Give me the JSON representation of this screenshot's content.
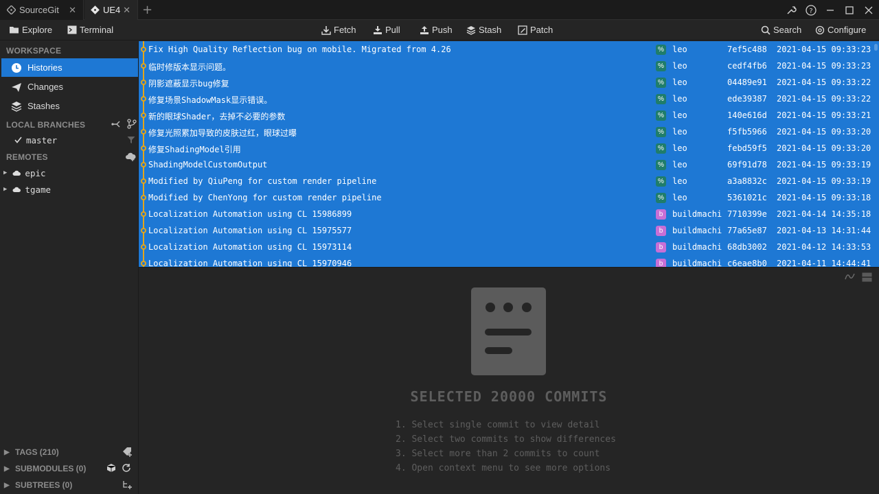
{
  "tabs": [
    {
      "label": "SourceGit",
      "close": "✕"
    },
    {
      "label": "UE4",
      "close": "✕"
    }
  ],
  "new_tab": "+",
  "toolbar": {
    "explore": "Explore",
    "terminal": "Terminal",
    "fetch": "Fetch",
    "pull": "Pull",
    "push": "Push",
    "stash": "Stash",
    "patch": "Patch",
    "search": "Search",
    "configure": "Configure"
  },
  "sidebar": {
    "workspace_title": "WORKSPACE",
    "nav": [
      {
        "label": "Histories",
        "icon": "clock-icon",
        "active": true
      },
      {
        "label": "Changes",
        "icon": "send-icon"
      },
      {
        "label": "Stashes",
        "icon": "stack-icon"
      }
    ],
    "local_branches_title": "LOCAL BRANCHES",
    "branches": [
      "master"
    ],
    "remotes_title": "REMOTES",
    "remotes": [
      "epic",
      "tgame"
    ],
    "tags": "TAGS (210)",
    "submodules": "SUBMODULES (0)",
    "subtrees": "SUBTREES (0)"
  },
  "commits": [
    {
      "subject": "Fix High Quality Reflection bug on mobile. Migrated from 4.26",
      "avatar": "%",
      "avatar_color": "#1f7d6b",
      "author": "leo",
      "sha": "7ef5c488",
      "time": "2021-04-15 09:33:23"
    },
    {
      "subject": "临时修版本显示问题。",
      "avatar": "%",
      "avatar_color": "#1f7d6b",
      "author": "leo",
      "sha": "cedf4fb6",
      "time": "2021-04-15 09:33:23"
    },
    {
      "subject": "阴影遮蔽显示bug修复",
      "avatar": "%",
      "avatar_color": "#1f7d6b",
      "author": "leo",
      "sha": "04489e91",
      "time": "2021-04-15 09:33:22"
    },
    {
      "subject": "修复场景ShadowMask显示错误。",
      "avatar": "%",
      "avatar_color": "#1f7d6b",
      "author": "leo",
      "sha": "ede39387",
      "time": "2021-04-15 09:33:22"
    },
    {
      "subject": "新的眼球Shader，去掉不必要的参数",
      "avatar": "%",
      "avatar_color": "#1f7d6b",
      "author": "leo",
      "sha": "140e616d",
      "time": "2021-04-15 09:33:21"
    },
    {
      "subject": "修复光照累加导致的皮肤过红，眼球过曝",
      "avatar": "%",
      "avatar_color": "#1f7d6b",
      "author": "leo",
      "sha": "f5fb5966",
      "time": "2021-04-15 09:33:20"
    },
    {
      "subject": "修复ShadingModel引用",
      "avatar": "%",
      "avatar_color": "#1f7d6b",
      "author": "leo",
      "sha": "febd59f5",
      "time": "2021-04-15 09:33:20"
    },
    {
      "subject": "ShadingModelCustomOutput",
      "avatar": "%",
      "avatar_color": "#1f7d6b",
      "author": "leo",
      "sha": "69f91d78",
      "time": "2021-04-15 09:33:19"
    },
    {
      "subject": "Modified by QiuPeng for custom render pipeline",
      "avatar": "%",
      "avatar_color": "#1f7d6b",
      "author": "leo",
      "sha": "a3a8832c",
      "time": "2021-04-15 09:33:19"
    },
    {
      "subject": "Modified by ChenYong for custom render pipeline",
      "avatar": "%",
      "avatar_color": "#1f7d6b",
      "author": "leo",
      "sha": "5361021c",
      "time": "2021-04-15 09:33:18"
    },
    {
      "subject": "Localization Automation using CL 15986899",
      "avatar": "b",
      "avatar_color": "#c86fd6",
      "author": "buildmachine",
      "sha": "7710399e",
      "time": "2021-04-14 14:35:18"
    },
    {
      "subject": "Localization Automation using CL 15975577",
      "avatar": "b",
      "avatar_color": "#c86fd6",
      "author": "buildmachine",
      "sha": "77a65e87",
      "time": "2021-04-13 14:31:44"
    },
    {
      "subject": "Localization Automation using CL 15973114",
      "avatar": "b",
      "avatar_color": "#c86fd6",
      "author": "buildmachine",
      "sha": "68db3002",
      "time": "2021-04-12 14:33:53"
    },
    {
      "subject": "Localization Automation using CL 15970946",
      "avatar": "b",
      "avatar_color": "#c86fd6",
      "author": "buildmachine",
      "sha": "c6eae8b0",
      "time": "2021-04-11 14:44:41"
    }
  ],
  "detail": {
    "title": "SELECTED 20000 COMMITS",
    "tips": [
      "1. Select single commit to view detail",
      "2. Select two commits to show differences",
      "3. Select more than 2 commits to count",
      "4. Open context menu to see more options"
    ]
  },
  "colors": {
    "accent": "#1e78d4",
    "graph": "#e3a51a"
  }
}
